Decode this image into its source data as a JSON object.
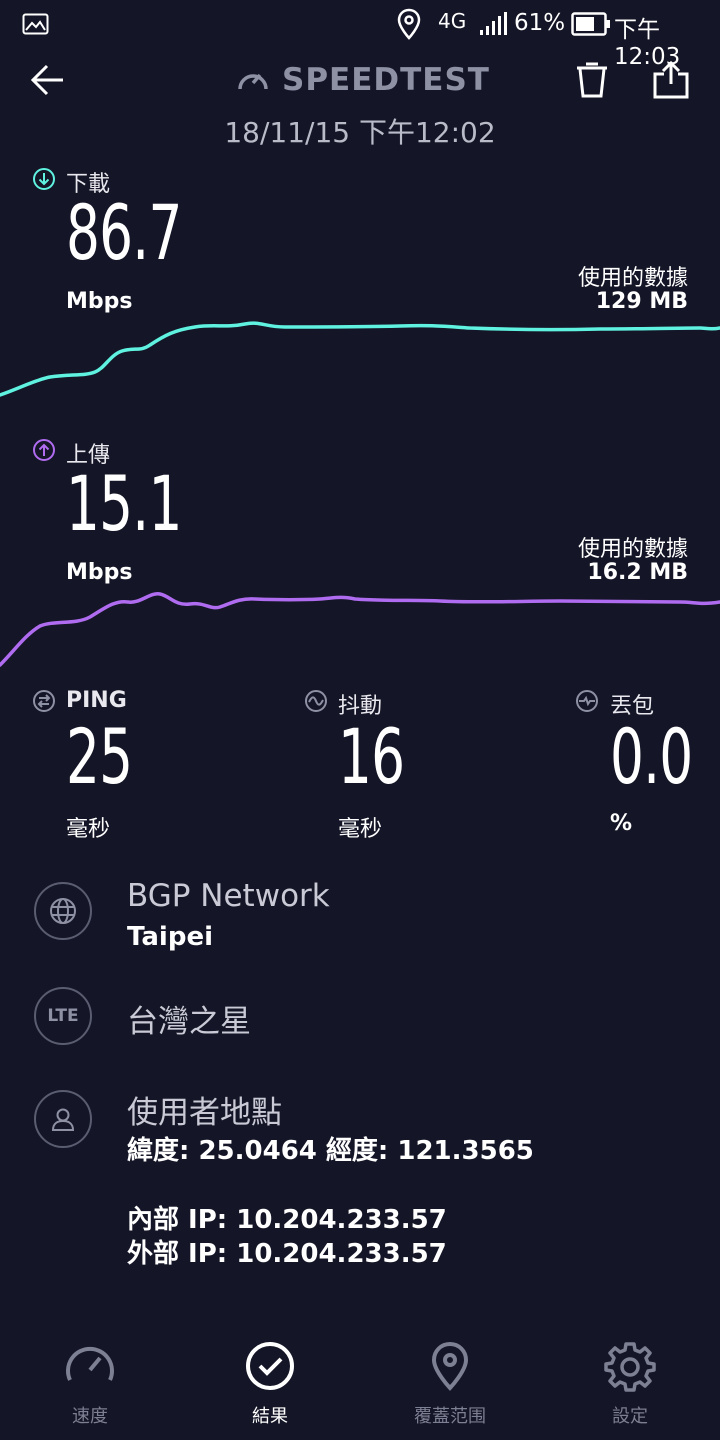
{
  "status_bar": {
    "network": "4G",
    "battery": "61%",
    "time": "下午12:03"
  },
  "header": {
    "title": "SPEEDTEST",
    "datetime": "18/11/15 下午12:02"
  },
  "download": {
    "label": "下載",
    "value": "86.7",
    "unit": "Mbps",
    "data_used_label": "使用的數據",
    "data_used": "129 MB",
    "color": "#5ff2e0"
  },
  "upload": {
    "label": "上傳",
    "value": "15.1",
    "unit": "Mbps",
    "data_used_label": "使用的數據",
    "data_used": "16.2 MB",
    "color": "#b06cf0"
  },
  "metrics": {
    "ping": {
      "label": "PING",
      "value": "25",
      "unit": "毫秒"
    },
    "jitter": {
      "label": "抖動",
      "value": "16",
      "unit": "毫秒"
    },
    "loss": {
      "label": "丟包",
      "value": "0.0",
      "unit": "%"
    }
  },
  "server": {
    "name": "BGP Network",
    "city": "Taipei"
  },
  "carrier": {
    "icon_text": "LTE",
    "name": "台灣之星"
  },
  "user": {
    "title": "使用者地點",
    "coords": "緯度: 25.0464 經度: 121.3565",
    "internal_ip": "內部 IP: 10.204.233.57",
    "external_ip": "外部 IP: 10.204.233.57"
  },
  "nav": {
    "speed": "速度",
    "results": "結果",
    "coverage": "覆蓋范围",
    "settings": "設定"
  }
}
